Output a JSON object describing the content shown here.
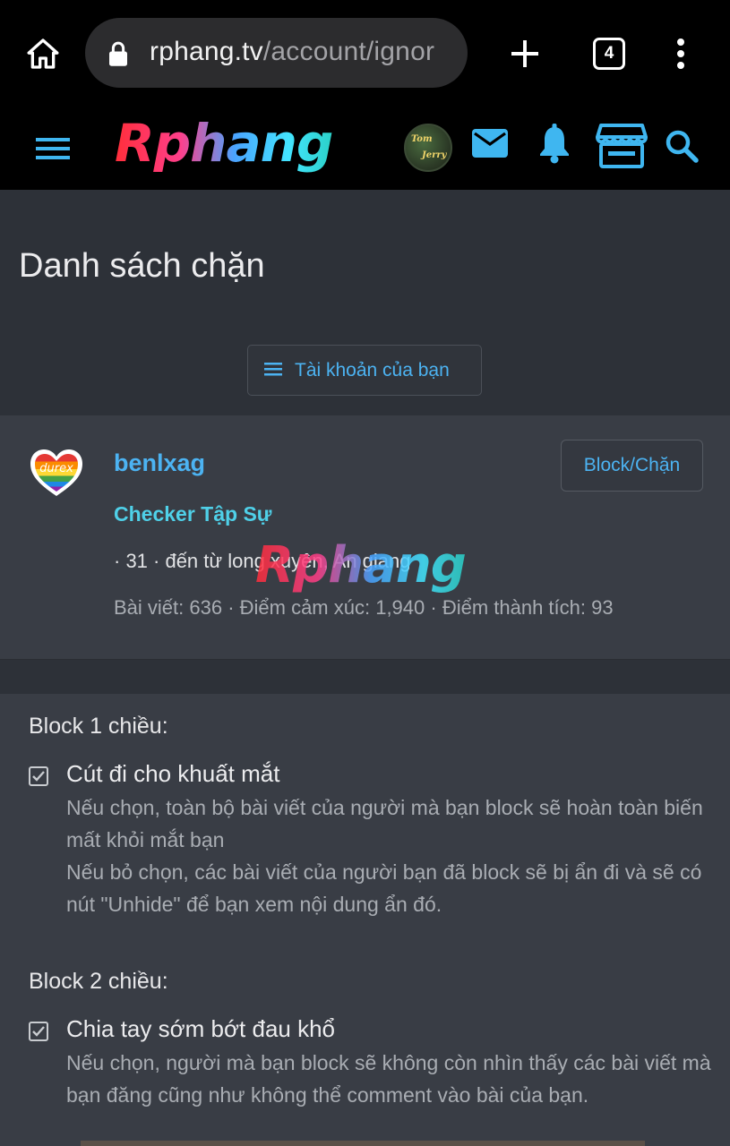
{
  "browser": {
    "url_domain": "rphang.tv",
    "url_path": "/account/ignor",
    "tab_count": "4"
  },
  "site": {
    "logo_text": "Rphang",
    "avatar_text_1": "Tom",
    "avatar_text_2": "Jerry"
  },
  "page": {
    "title": "Danh sách chặn",
    "account_button": "Tài khoản của bạn"
  },
  "blocked_user": {
    "avatar_label": "durex",
    "username": "benlxag",
    "title": "Checker Tập Sự",
    "meta": "· 31 · đến từ long xuyên, An giang",
    "stats": "Bài viết: 636 · Điểm cảm xúc: 1,940 · Điểm thành tích: 93",
    "block_button": "Block/Chặn",
    "watermark": "Rphang"
  },
  "options": {
    "one_way": {
      "heading": "Block 1 chiều:",
      "option_label": "Cút đi cho khuất mắt",
      "checked": true,
      "hint_1": "Nếu chọn, toàn bộ bài viết của người mà bạn block sẽ hoàn toàn biến mất khỏi mắt bạn",
      "hint_2": "Nếu bỏ chọn, các bài viết của người bạn đã block sẽ bị ẩn đi và sẽ có nút \"Unhide\" để bạn xem nội dung ẩn đó."
    },
    "two_way": {
      "heading": "Block 2 chiều:",
      "option_label": "Chia tay sớm bớt đau khổ",
      "checked": true,
      "hint_1": "Nếu chọn, người mà bạn block sẽ không còn nhìn thấy các bài viết mà bạn đăng cũng như không thể comment vào bài của bạn."
    }
  },
  "colors": {
    "accent_link": "#4cb3f2",
    "user_title": "#4fd0e8",
    "icon_blue": "#3fb6f0",
    "background": "#2d3138",
    "card": "#393d45"
  }
}
